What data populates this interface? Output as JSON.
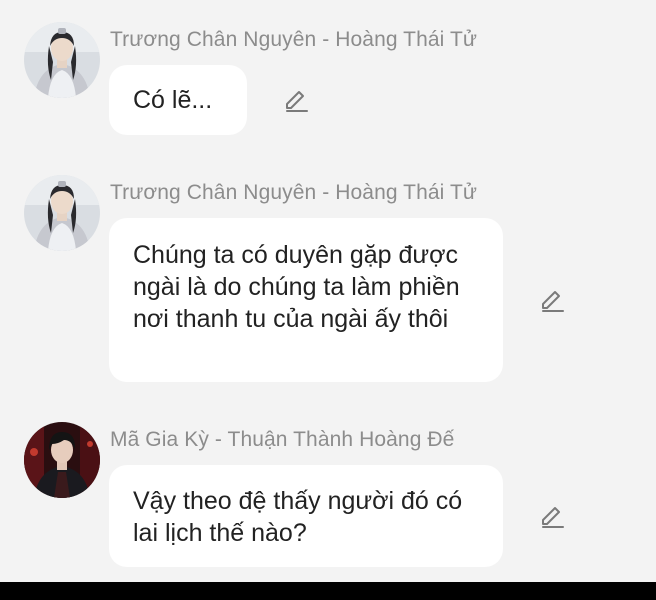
{
  "messages": [
    {
      "sender": "Trương Chân Nguyên - Hoàng Thái Tử",
      "text": "Có lẽ...",
      "avatar_icon": "person-white-robe-avatar",
      "edit_icon": "pencil-edit-icon"
    },
    {
      "sender": "Trương Chân Nguyên - Hoàng Thái Tử",
      "text": "Chúng ta có duyên gặp được ngài là do chúng ta làm phiền nơi thanh tu của ngài ấy thôi",
      "avatar_icon": "person-white-robe-avatar",
      "edit_icon": "pencil-edit-icon"
    },
    {
      "sender": "Mã Gia Kỳ - Thuận Thành Hoàng Đế",
      "text": "Vậy theo đệ thấy người đó có lai lịch thế nào?",
      "avatar_icon": "person-dark-red-avatar",
      "edit_icon": "pencil-edit-icon"
    }
  ],
  "colors": {
    "background": "#f3f3f3",
    "bubble": "#ffffff",
    "sender_text": "#8c8c8c",
    "message_text": "#222222",
    "icon": "#7a7a7a"
  }
}
